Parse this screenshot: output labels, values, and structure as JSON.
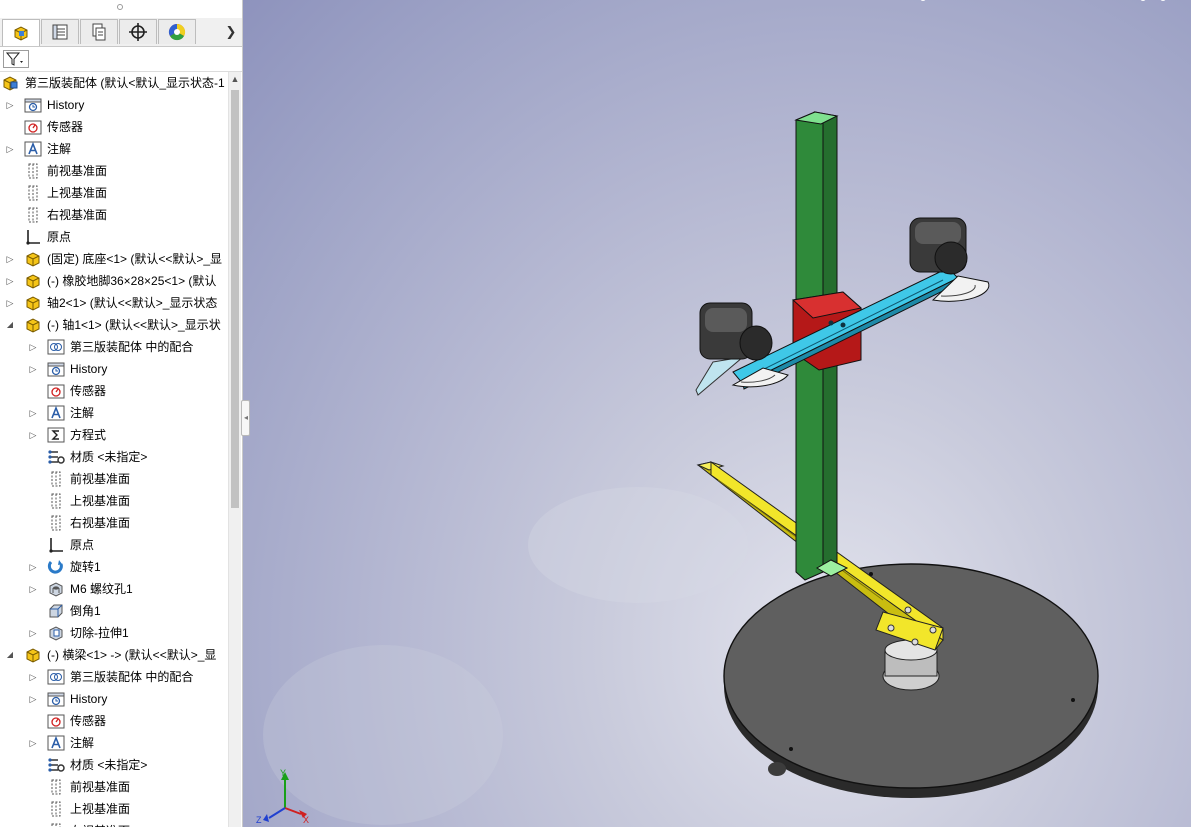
{
  "tabs": [
    {
      "name": "featuremanager-tab",
      "icon": "featuremanager-icon",
      "active": true
    },
    {
      "name": "propertymanager-tab",
      "icon": "propertymanager-icon",
      "active": false
    },
    {
      "name": "configurationmanager-tab",
      "icon": "configurationmanager-icon",
      "active": false
    },
    {
      "name": "dimxpertmanager-tab",
      "icon": "dimxpert-icon",
      "active": false
    },
    {
      "name": "displaymanager-tab",
      "icon": "displaymanager-icon",
      "active": false
    }
  ],
  "tree": [
    {
      "depth": 0,
      "arrow": "",
      "icon": "assembly-icon",
      "label": "第三版装配体  (默认<默认_显示状态-1"
    },
    {
      "depth": 1,
      "arrow": "right",
      "icon": "history-icon",
      "label": "History"
    },
    {
      "depth": 1,
      "arrow": "",
      "icon": "sensor-icon",
      "label": "传感器"
    },
    {
      "depth": 1,
      "arrow": "right",
      "icon": "annotation-icon",
      "label": "注解"
    },
    {
      "depth": 1,
      "arrow": "",
      "icon": "plane-icon",
      "label": "前视基准面"
    },
    {
      "depth": 1,
      "arrow": "",
      "icon": "plane-icon",
      "label": "上视基准面"
    },
    {
      "depth": 1,
      "arrow": "",
      "icon": "plane-icon",
      "label": "右视基准面"
    },
    {
      "depth": 1,
      "arrow": "",
      "icon": "origin-icon",
      "label": "原点"
    },
    {
      "depth": 1,
      "arrow": "right",
      "icon": "part-icon",
      "label": "(固定) 底座<1> (默认<<默认>_显"
    },
    {
      "depth": 1,
      "arrow": "right",
      "icon": "part-icon",
      "label": "(-) 橡胶地脚36×28×25<1> (默认"
    },
    {
      "depth": 1,
      "arrow": "right",
      "icon": "part-icon",
      "label": "轴2<1> (默认<<默认>_显示状态"
    },
    {
      "depth": 1,
      "arrow": "down",
      "icon": "part-icon",
      "label": "(-) 轴1<1> (默认<<默认>_显示状"
    },
    {
      "depth": 2,
      "arrow": "right",
      "icon": "mates-icon",
      "label": "第三版装配体 中的配合"
    },
    {
      "depth": 2,
      "arrow": "right",
      "icon": "history-icon",
      "label": "History"
    },
    {
      "depth": 2,
      "arrow": "",
      "icon": "sensor-icon",
      "label": "传感器"
    },
    {
      "depth": 2,
      "arrow": "right",
      "icon": "annotation-icon",
      "label": "注解"
    },
    {
      "depth": 2,
      "arrow": "right",
      "icon": "equation-icon",
      "label": "方程式"
    },
    {
      "depth": 2,
      "arrow": "",
      "icon": "material-icon",
      "label": "材质 <未指定>"
    },
    {
      "depth": 2,
      "arrow": "",
      "icon": "plane-icon",
      "label": "前视基准面"
    },
    {
      "depth": 2,
      "arrow": "",
      "icon": "plane-icon",
      "label": "上视基准面"
    },
    {
      "depth": 2,
      "arrow": "",
      "icon": "plane-icon",
      "label": "右视基准面"
    },
    {
      "depth": 2,
      "arrow": "",
      "icon": "origin-icon",
      "label": "原点"
    },
    {
      "depth": 2,
      "arrow": "right",
      "icon": "revolve-icon",
      "label": "旋转1"
    },
    {
      "depth": 2,
      "arrow": "right",
      "icon": "hole-icon",
      "label": "M6 螺纹孔1"
    },
    {
      "depth": 2,
      "arrow": "",
      "icon": "chamfer-icon",
      "label": "倒角1"
    },
    {
      "depth": 2,
      "arrow": "right",
      "icon": "cut-extrude-icon",
      "label": "切除-拉伸1"
    },
    {
      "depth": 1,
      "arrow": "down",
      "icon": "part-icon",
      "label": "(-) 横梁<1> -> (默认<<默认>_显"
    },
    {
      "depth": 2,
      "arrow": "right",
      "icon": "mates-icon",
      "label": "第三版装配体 中的配合"
    },
    {
      "depth": 2,
      "arrow": "right",
      "icon": "history-icon",
      "label": "History"
    },
    {
      "depth": 2,
      "arrow": "",
      "icon": "sensor-icon",
      "label": "传感器"
    },
    {
      "depth": 2,
      "arrow": "right",
      "icon": "annotation-icon",
      "label": "注解"
    },
    {
      "depth": 2,
      "arrow": "",
      "icon": "material-icon",
      "label": "材质 <未指定>"
    },
    {
      "depth": 2,
      "arrow": "",
      "icon": "plane-icon",
      "label": "前视基准面"
    },
    {
      "depth": 2,
      "arrow": "",
      "icon": "plane-icon",
      "label": "上视基准面"
    },
    {
      "depth": 2,
      "arrow": "",
      "icon": "plane-icon",
      "label": "右视基准面"
    }
  ],
  "viewport": {
    "triad_axes": [
      "X",
      "Y",
      "Z"
    ],
    "colors": {
      "column": "#2f8a3a",
      "column_top": "#7fe08f",
      "clamp_block": "#c01818",
      "crossbar": "#3fc8e8",
      "arm": "#f2e62a",
      "base_disc": "#5a5a5a",
      "camera": "#3a3a3a"
    }
  }
}
